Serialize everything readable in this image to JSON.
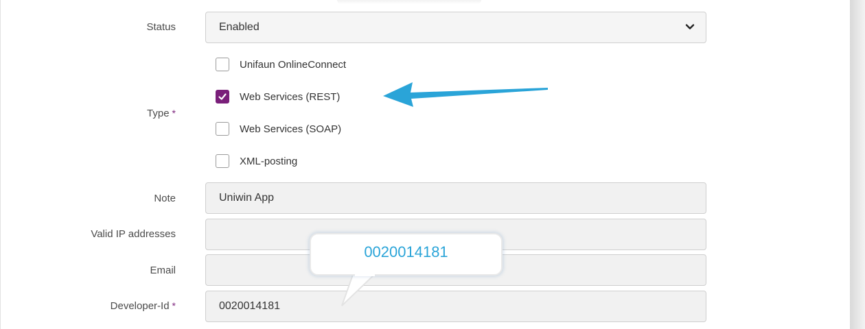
{
  "status": {
    "label": "Status",
    "value": "Enabled"
  },
  "type": {
    "label": "Type",
    "required_mark": "*",
    "options": [
      {
        "label": "Unifaun OnlineConnect",
        "checked": false
      },
      {
        "label": "Web Services (REST)",
        "checked": true
      },
      {
        "label": "Web Services (SOAP)",
        "checked": false
      },
      {
        "label": "XML-posting",
        "checked": false
      }
    ]
  },
  "note": {
    "label": "Note",
    "value": "Uniwin App"
  },
  "valid_ip": {
    "label": "Valid IP addresses",
    "value": ""
  },
  "email": {
    "label": "Email",
    "value": ""
  },
  "developer_id": {
    "label": "Developer-Id",
    "required_mark": "*",
    "value": "0020014181"
  },
  "callout": {
    "text": "0020014181"
  },
  "colors": {
    "accent": "#7a1f7a",
    "arrow": "#2aa4d8"
  }
}
